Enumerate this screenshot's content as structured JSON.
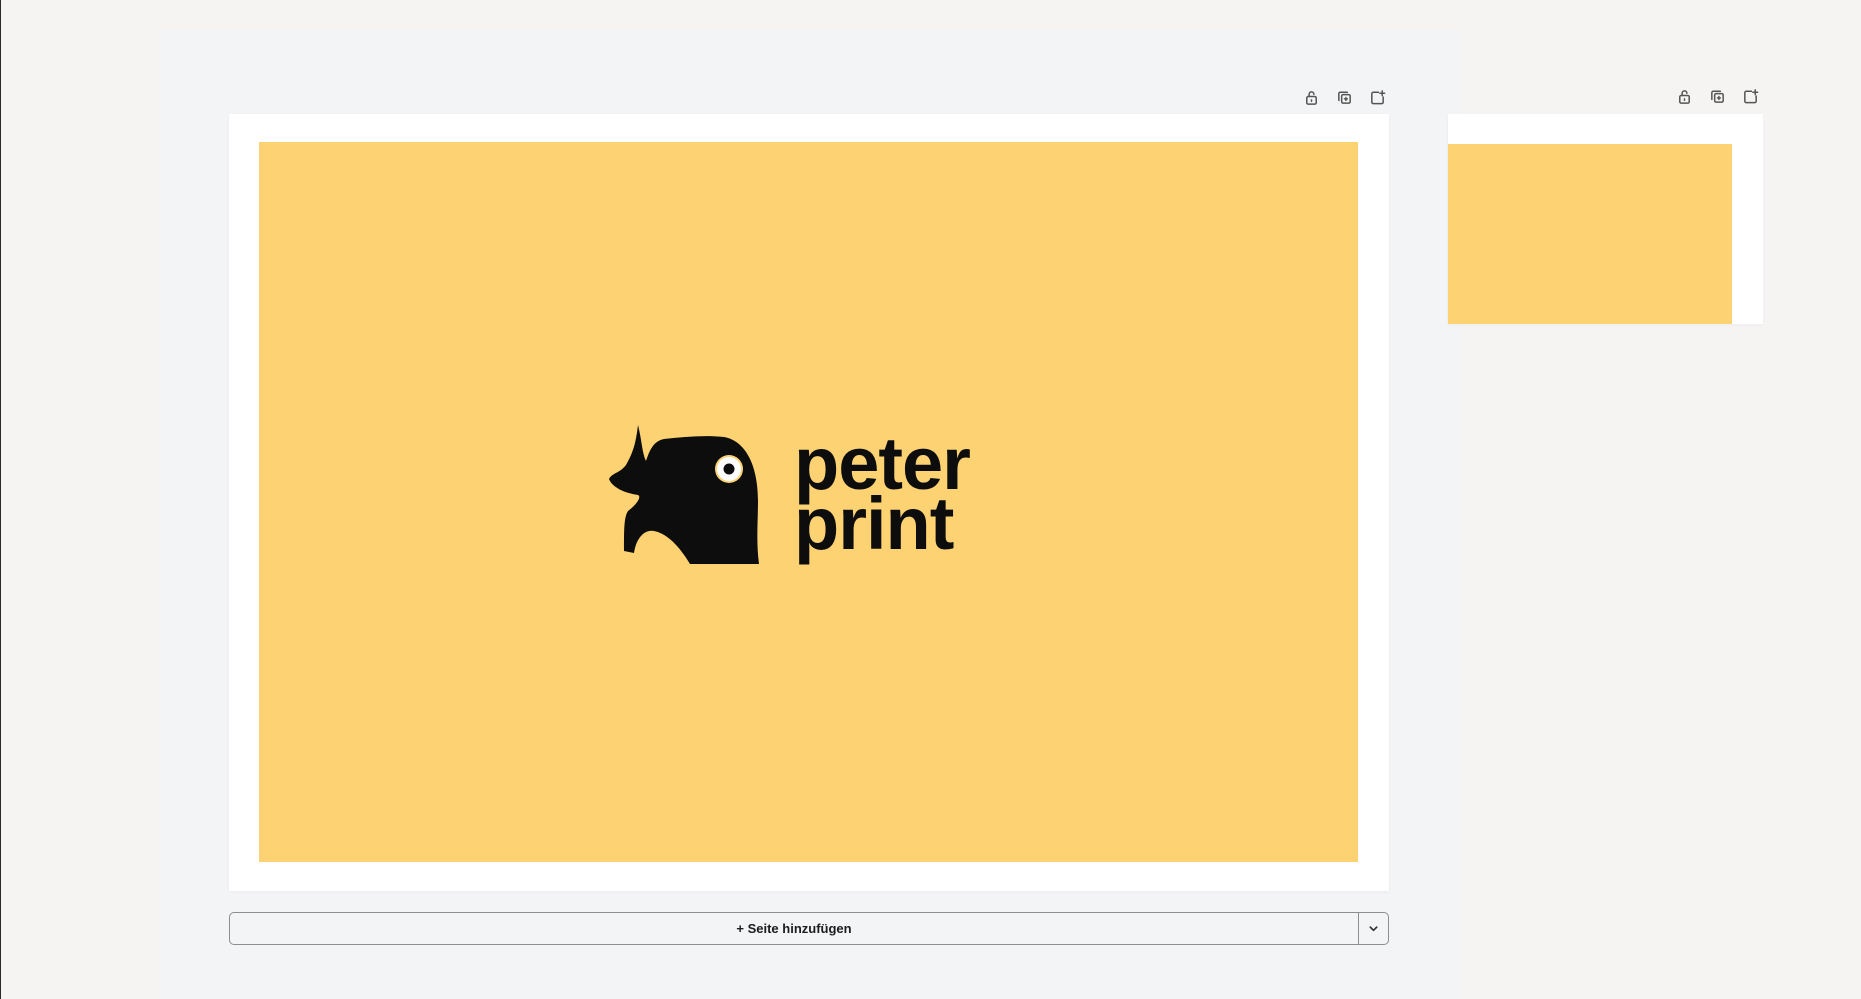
{
  "colors": {
    "page_background": "#fdd273",
    "frame": "#ffffff",
    "logo": "#0d0d0d"
  },
  "pages": [
    {
      "toolbar_icons": [
        "unlock-icon",
        "duplicate-icon",
        "add-page-icon"
      ]
    },
    {
      "toolbar_icons": [
        "unlock-icon",
        "duplicate-icon",
        "add-page-icon"
      ]
    }
  ],
  "logo": {
    "line1": "peter",
    "line2": "print"
  },
  "add_page": {
    "label": "+ Seite hinzufügen",
    "dropdown_icon": "chevron-down-icon"
  }
}
